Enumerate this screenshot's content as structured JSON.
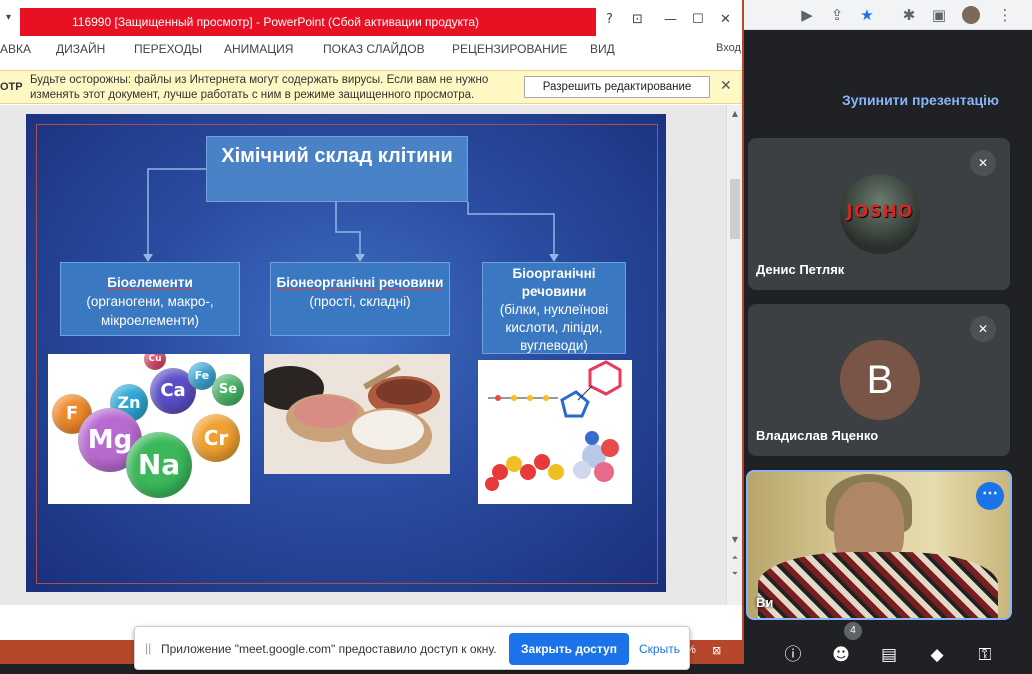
{
  "ppt": {
    "title": "116990 [Защищенный просмотр] -  PowerPoint (Сбой активации продукта)",
    "window_buttons": {
      "help": "?",
      "restore_ribbon": "⊡",
      "minimize": "—",
      "maximize": "☐",
      "close": "✕"
    },
    "ribbon_tabs": [
      "АВКА",
      "ДИЗАЙН",
      "ПЕРЕХОДЫ",
      "АНИМАЦИЯ",
      "ПОКАЗ СЛАЙДОВ",
      "РЕЦЕНЗИРОВАНИЕ",
      "ВИД"
    ],
    "signin": "Вход",
    "protected_label": "ОТР",
    "protected_message": "Будьте осторожны: файлы из Интернета могут содержать вирусы. Если вам не нужно изменять этот документ, лучше работать с ним в режиме защищенного просмотра.",
    "enable_editing": "Разрешить редактирование",
    "zoom_percent": "%"
  },
  "slide": {
    "title": "Хімічний склад клітини",
    "boxes": [
      {
        "heading": "Біоелементи",
        "detail": "(органогени, макро-, мікроелементи)"
      },
      {
        "heading": "Біонеорганічні речовини",
        "detail": "(прості, складні)"
      },
      {
        "heading": "Біоорганічні речовини",
        "detail": "(білки, нуклеїнові кислоти, ліпіди, вуглеводи)"
      }
    ],
    "elements": [
      "Cu",
      "Zn",
      "Ca",
      "Fe",
      "Se",
      "F",
      "Mg",
      "Na",
      "Cr"
    ]
  },
  "share_bar": {
    "grip": "||",
    "message": "Приложение \"meet.google.com\" предоставило доступ к окну.",
    "stop_label": "Закрыть доступ",
    "hide_label": "Скрыть"
  },
  "meet": {
    "stop_presenting": "Зупинити презентацію",
    "participants": [
      {
        "name": "Денис Петляк",
        "avatar_text": "JOSHO"
      },
      {
        "name": "Владислав Яценко",
        "avatar_letter": "B"
      },
      {
        "name": "Ви"
      }
    ],
    "participant_count": "4",
    "accent": "#8ab4f8"
  }
}
